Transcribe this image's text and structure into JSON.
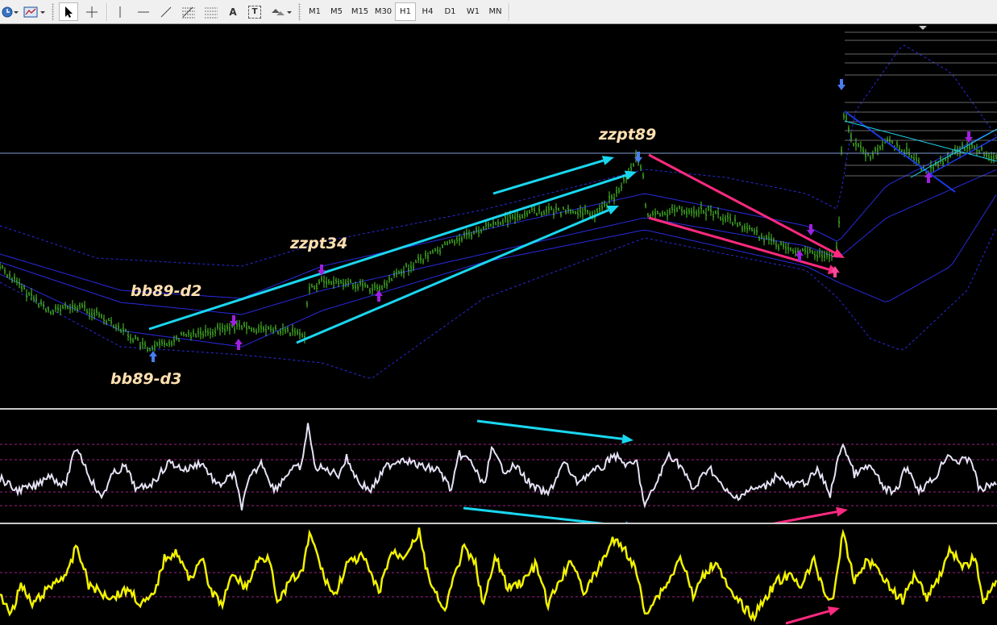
{
  "toolbar": {
    "icons": [
      "clock-icon",
      "indicators-icon",
      "cursor-icon",
      "crosshair-icon",
      "vertical-line-icon",
      "horizontal-line-icon",
      "trendline-icon",
      "fibonacci-icon",
      "fibo-channel-icon",
      "text-icon",
      "text-label-icon",
      "arrow-shapes-icon"
    ],
    "text_tool": "A",
    "text_label_tool": "T",
    "timeframes": [
      "M1",
      "M5",
      "M15",
      "M30",
      "H1",
      "H4",
      "D1",
      "W1",
      "MN"
    ],
    "active_timeframe": "H1"
  },
  "chart": {
    "annotations": [
      "bb89-d2",
      "bb89-d3",
      "zzpt34",
      "zzpt89"
    ],
    "colors": {
      "background": "#000000",
      "candles": "#4fd12a",
      "bands": "#2a2ae0",
      "cyan_arrows": "#1ad7f0",
      "pink_arrows": "#ff2a7f",
      "osc1_line": "#e6e2f5",
      "osc2_line": "#f2f200",
      "level_lines": "#a0208a",
      "fractal_arrows": "#a020e0",
      "horizontal_line": "#7f9bd6"
    }
  }
}
